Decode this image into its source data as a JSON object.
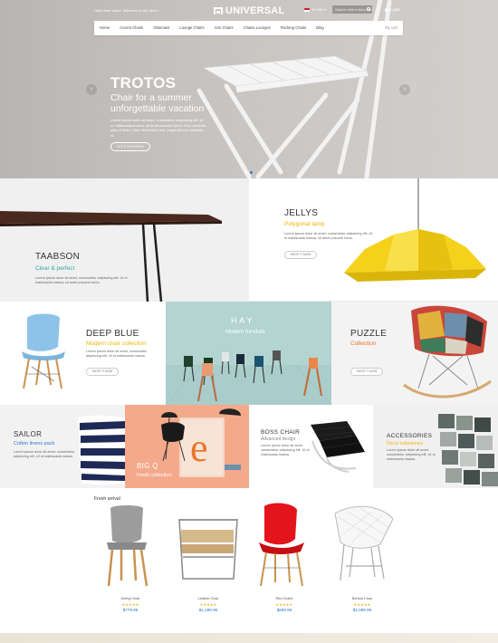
{
  "header": {
    "welcome": "Hello dear visitor. Welcome to our store!",
    "logo": "UNIVERSAL",
    "currency": "$ USD ▾",
    "search_placeholder": "Search entire store her",
    "login": "Login"
  },
  "nav": {
    "items": [
      "Home",
      "Accent Chairs",
      "Ottomans",
      "Lounge Chairs",
      "Arm Chairs",
      "Chaise Lounges",
      "Rocking Chairs",
      "Blog"
    ],
    "cart": "My cart"
  },
  "hero": {
    "title": "TROTOS",
    "subtitle": "Chair for a summer unforgettable vacation",
    "text": "Lorem ipsum dolor sit amet, consectetur adipiscing elit. Ut ut malesuada massa, sit amet posuere tortor. Duis vehicula odio ut libero. Nam fermentum est, imperdiet nec molestie id.",
    "button": "LET'S SHOPPING"
  },
  "promos": {
    "taabson": {
      "title": "TAABSON",
      "subtitle": "Clear & perfect",
      "text": "Lorem ipsum dolor sit amet, consectetur adipiscing elit. Ut ut malesuada massa, sit amet posuere tortor."
    },
    "jellys": {
      "title": "JELLYS",
      "subtitle": "Polygonal lamp",
      "text": "Lorem ipsum dolor sit amet, consectetur adipiscing elit. Ut ut malesuada massa, sit amet posuere tortor.",
      "button": "SHOP IT NOW"
    },
    "deepblue": {
      "title": "DEEP BLUE",
      "subtitle": "Modern chair collection",
      "text": "Lorem ipsum dolor sit amet, consectetur adipiscing elit. Ut ut malesuada massa.",
      "button": "SHOP IT NOW"
    },
    "hay": {
      "title": "H A Y",
      "subtitle": "Modern furniture"
    },
    "puzzle": {
      "title": "PUZZLE",
      "subtitle": "Collection",
      "button": "SHOP IT NOW"
    },
    "sailor": {
      "title": "SAILOR",
      "subtitle": "Cotton linens pack",
      "text": "Lorem ipsum dolor sit amet, consectetur adipiscing elit. Ut ut malesuada massa."
    },
    "bigq": {
      "title": "BIG Q",
      "subtitle": "Fresh collection"
    },
    "boss": {
      "title": "BOSS CHAIR",
      "subtitle": "Advanced design",
      "text": "Lorem ipsum dolor sit amet, consectetur adipiscing elit. Ut ut malesuada massa."
    },
    "accessories": {
      "title": "ACCESSORIES",
      "subtitle": "Decor cubestones",
      "text": "Lorem ipsum dolor sit amet, consectetur adipiscing elit. Ut ut malesuada massa."
    }
  },
  "fresh": {
    "title": "Fresh arrival",
    "products": [
      {
        "name": "Dining Chair",
        "stars": "★★★★★",
        "price": "$779.99"
      },
      {
        "name": "Leather Chair",
        "stars": "★★★★★",
        "price": "$1,299.99"
      },
      {
        "name": "Red Chairs",
        "stars": "★★★★★",
        "price": "$699.99"
      },
      {
        "name": "Bertoia Chair",
        "stars": "★★★★★",
        "price": "$1,099.99"
      }
    ]
  },
  "colors": {
    "accent_blue": "#2f74c9",
    "accent_yellow": "#f0b400",
    "accent_green": "#3aa6a0",
    "accent_orange": "#e9762b"
  }
}
